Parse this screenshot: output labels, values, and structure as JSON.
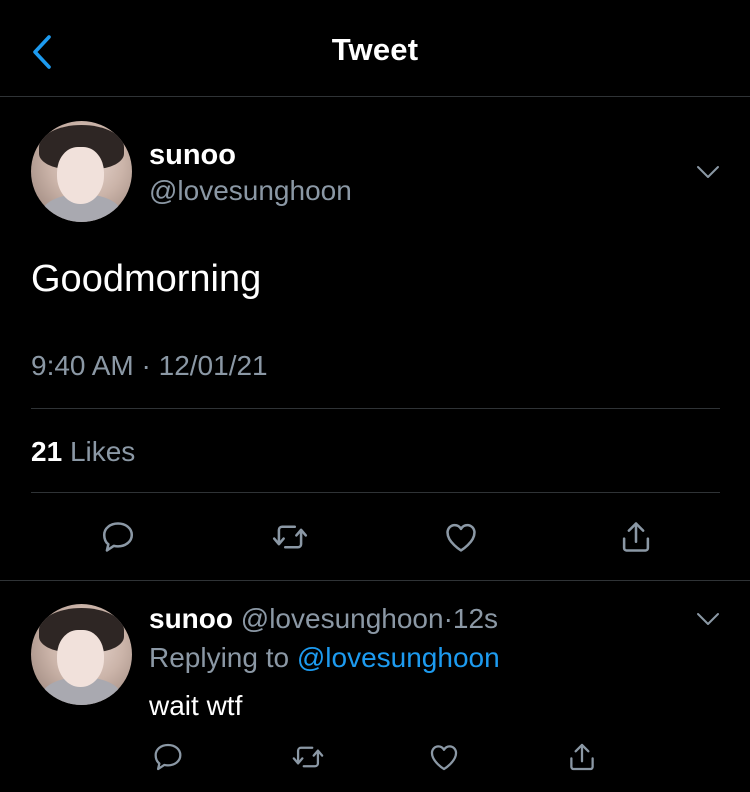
{
  "nav": {
    "title": "Tweet",
    "back_icon": "chevron-left-icon"
  },
  "colors": {
    "background": "#000000",
    "text": "#ffffff",
    "secondary_text": "#8b98a5",
    "accent": "#1d9bf0",
    "divider": "#2f3336"
  },
  "tweet": {
    "author_name": "sunoo",
    "author_handle": "@lovesunghoon",
    "text": "Goodmorning",
    "time": "9:40 AM",
    "separator": "·",
    "date": "12/01/21",
    "likes_count": "21",
    "likes_label": "Likes",
    "actions": [
      "reply-icon",
      "retweet-icon",
      "like-icon",
      "share-icon"
    ]
  },
  "reply": {
    "author_name": "sunoo",
    "author_handle": "@lovesunghoon",
    "separator": "·",
    "time_ago": "12s",
    "replying_prefix": "Replying to",
    "replying_to": "@lovesunghoon",
    "text": "wait wtf",
    "actions": [
      "reply-icon",
      "retweet-icon",
      "like-icon",
      "share-icon"
    ]
  }
}
